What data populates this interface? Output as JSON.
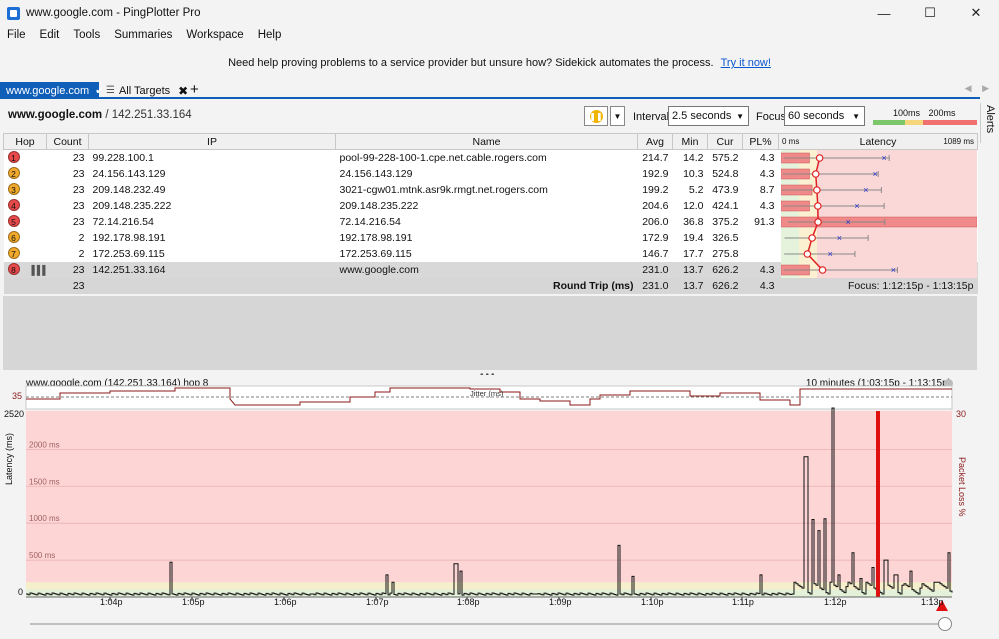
{
  "window": {
    "title": "www.google.com - PingPlotter Pro",
    "minimize": "—",
    "maximize": "☐",
    "close": "✕"
  },
  "menu": [
    "File",
    "Edit",
    "Tools",
    "Summaries",
    "Workspace",
    "Help"
  ],
  "promo": {
    "text": "Need help proving problems to a service provider but unsure how? Sidekick automates the process.",
    "link": "Try it now!"
  },
  "tabs": {
    "active": "www.google.com",
    "all": "All Targets",
    "add": "+"
  },
  "toolbar": {
    "target_host": "www.google.com",
    "target_ip": "/ 142.251.33.164",
    "interval_label": "Interval",
    "interval_value": "2.5 seconds",
    "focus_label": "Focus",
    "focus_value": "60 seconds",
    "legend_100": "100ms",
    "legend_200": "200ms",
    "alerts": "Alerts"
  },
  "table": {
    "headers": {
      "hop": "Hop",
      "count": "Count",
      "ip": "IP",
      "name": "Name",
      "avg": "Avg",
      "min": "Min",
      "cur": "Cur",
      "pl": "PL%",
      "lat_zero": "0 ms",
      "latency": "Latency",
      "lat_max": "1089 ms"
    },
    "rows": [
      {
        "hop": "1",
        "count": "23",
        "ip": "99.228.100.1",
        "name": "pool-99-228-100-1.cpe.net.cable.rogers.com",
        "avg": "214.7",
        "min": "14.2",
        "cur": "575.2",
        "pl": "4.3",
        "color": "#e84a4a"
      },
      {
        "hop": "2",
        "count": "23",
        "ip": "24.156.143.129",
        "name": "24.156.143.129",
        "avg": "192.9",
        "min": "10.3",
        "cur": "524.8",
        "pl": "4.3",
        "color": "#f0a92b"
      },
      {
        "hop": "3",
        "count": "23",
        "ip": "209.148.232.49",
        "name": "3021-cgw01.mtnk.asr9k.rmgt.net.rogers.com",
        "avg": "199.2",
        "min": "5.2",
        "cur": "473.9",
        "pl": "8.7",
        "color": "#f0a92b"
      },
      {
        "hop": "4",
        "count": "23",
        "ip": "209.148.235.222",
        "name": "209.148.235.222",
        "avg": "204.6",
        "min": "12.0",
        "cur": "424.1",
        "pl": "4.3",
        "color": "#e84a4a"
      },
      {
        "hop": "5",
        "count": "23",
        "ip": "72.14.216.54",
        "name": "72.14.216.54",
        "avg": "206.0",
        "min": "36.8",
        "cur": "375.2",
        "pl": "91.3",
        "color": "#e84a4a"
      },
      {
        "hop": "6",
        "count": "2",
        "ip": "192.178.98.191",
        "name": "192.178.98.191",
        "avg": "172.9",
        "min": "19.4",
        "cur": "326.5",
        "pl": "",
        "color": "#f0a92b"
      },
      {
        "hop": "7",
        "count": "2",
        "ip": "172.253.69.115",
        "name": "172.253.69.115",
        "avg": "146.7",
        "min": "17.7",
        "cur": "275.8",
        "pl": "",
        "color": "#f0a92b"
      },
      {
        "hop": "8",
        "count": "23",
        "ip": "142.251.33.164",
        "name": "www.google.com",
        "avg": "231.0",
        "min": "13.7",
        "cur": "626.2",
        "pl": "4.3",
        "color": "#e84a4a"
      }
    ],
    "summary": {
      "count": "23",
      "label": "Round Trip (ms)",
      "avg": "231.0",
      "min": "13.7",
      "cur": "626.2",
      "pl": "4.3",
      "focus": "Focus: 1:12:15p - 1:13:15p"
    }
  },
  "graph": {
    "title": "www.google.com (142.251.33.164) hop 8",
    "range": "10 minutes (1:03:15p - 1:13:15p)",
    "jitter_label": "Jitter (ms)",
    "jitter_max": "35",
    "y_max": "2520",
    "y_zero": "0",
    "y_label": "Latency (ms)",
    "y2_max": "30",
    "y2_label": "Packet Loss %",
    "gridlines": [
      "2000 ms",
      "1500 ms",
      "1000 ms",
      "500 ms"
    ],
    "x_ticks": [
      "1:04p",
      "1:05p",
      "1:06p",
      "1:07p",
      "1:08p",
      "1:09p",
      "1:10p",
      "1:11p",
      "1:12p",
      "1:13p"
    ]
  }
}
